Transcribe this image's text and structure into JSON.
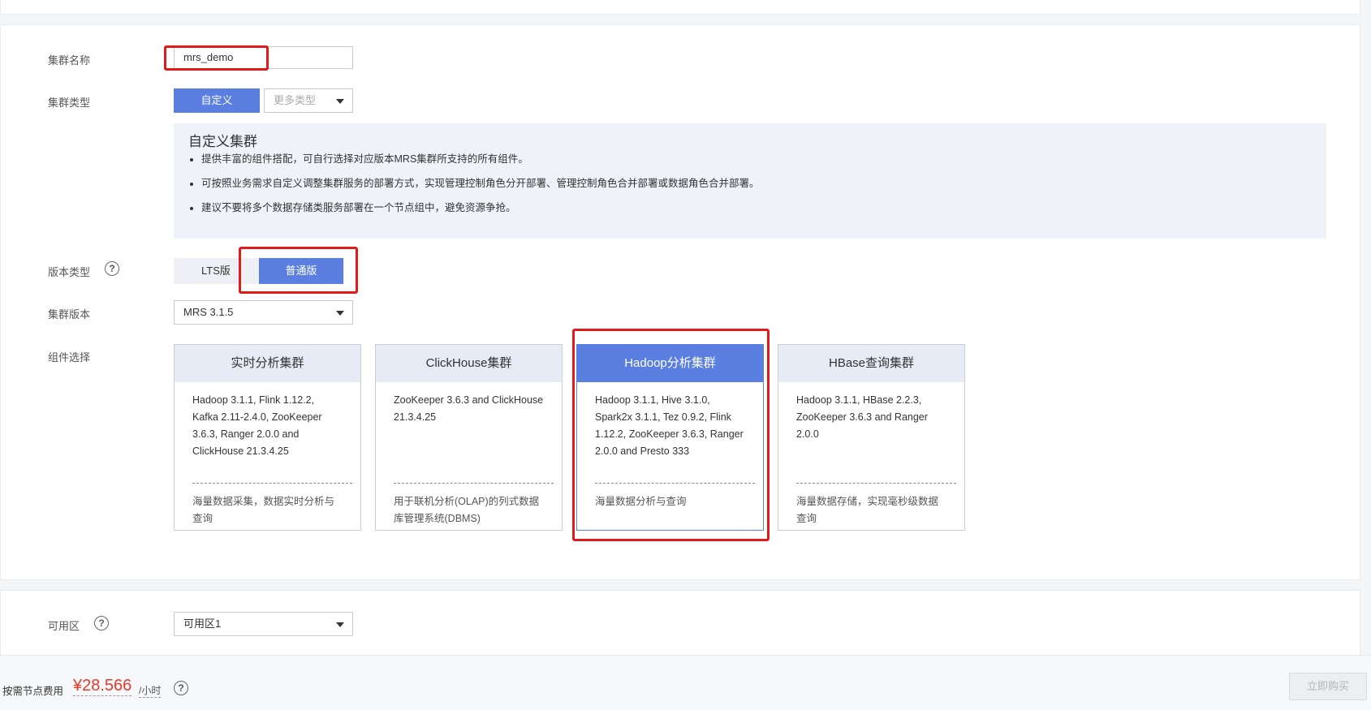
{
  "cluster_name": {
    "label": "集群名称",
    "value": "mrs_demo"
  },
  "cluster_type": {
    "label": "集群类型",
    "custom_button": "自定义",
    "more_types_placeholder": "更多类型",
    "desc_title": "自定义集群",
    "desc_items": [
      "提供丰富的组件搭配，可自行选择对应版本MRS集群所支持的所有组件。",
      "可按照业务需求自定义调整集群服务的部署方式，实现管理控制角色分开部署、管理控制角色合并部署或数据角色合并部署。",
      "建议不要将多个数据存储类服务部署在一个节点组中，避免资源争抢。"
    ]
  },
  "version_type": {
    "label": "版本类型",
    "help": "?",
    "options": [
      "LTS版",
      "普通版"
    ],
    "selected": "普通版"
  },
  "cluster_version": {
    "label": "集群版本",
    "value": "MRS 3.1.5"
  },
  "components": {
    "label": "组件选择",
    "cards": [
      {
        "title": "实时分析集群",
        "body": "Hadoop 3.1.1, Flink 1.12.2, Kafka 2.11-2.4.0, ZooKeeper 3.6.3, Ranger 2.0.0 and ClickHouse 21.3.4.25",
        "desc": "海量数据采集，数据实时分析与查询"
      },
      {
        "title": "ClickHouse集群",
        "body": "ZooKeeper 3.6.3 and ClickHouse 21.3.4.25",
        "desc": "用于联机分析(OLAP)的列式数据库管理系统(DBMS)"
      },
      {
        "title": "Hadoop分析集群",
        "body": "Hadoop 3.1.1, Hive 3.1.0, Spark2x 3.1.1, Tez 0.9.2, Flink 1.12.2, ZooKeeper 3.6.3, Ranger 2.0.0 and Presto 333",
        "desc": "海量数据分析与查询"
      },
      {
        "title": "HBase查询集群",
        "body": "Hadoop 3.1.1, HBase 2.2.3, ZooKeeper 3.6.3 and Ranger 2.0.0",
        "desc": "海量数据存储，实现毫秒级数据查询"
      }
    ],
    "selected": "Hadoop分析集群"
  },
  "availability_zone": {
    "label": "可用区",
    "help": "?",
    "value": "可用区1"
  },
  "footer": {
    "fee_label": "按需节点费用",
    "price": "¥28.566",
    "unit": "/小时",
    "help": "?",
    "buy_button": "立即购买"
  },
  "colors": {
    "primary": "#5a7fe0",
    "highlight": "#e21a1a",
    "price": "#e9392a"
  }
}
